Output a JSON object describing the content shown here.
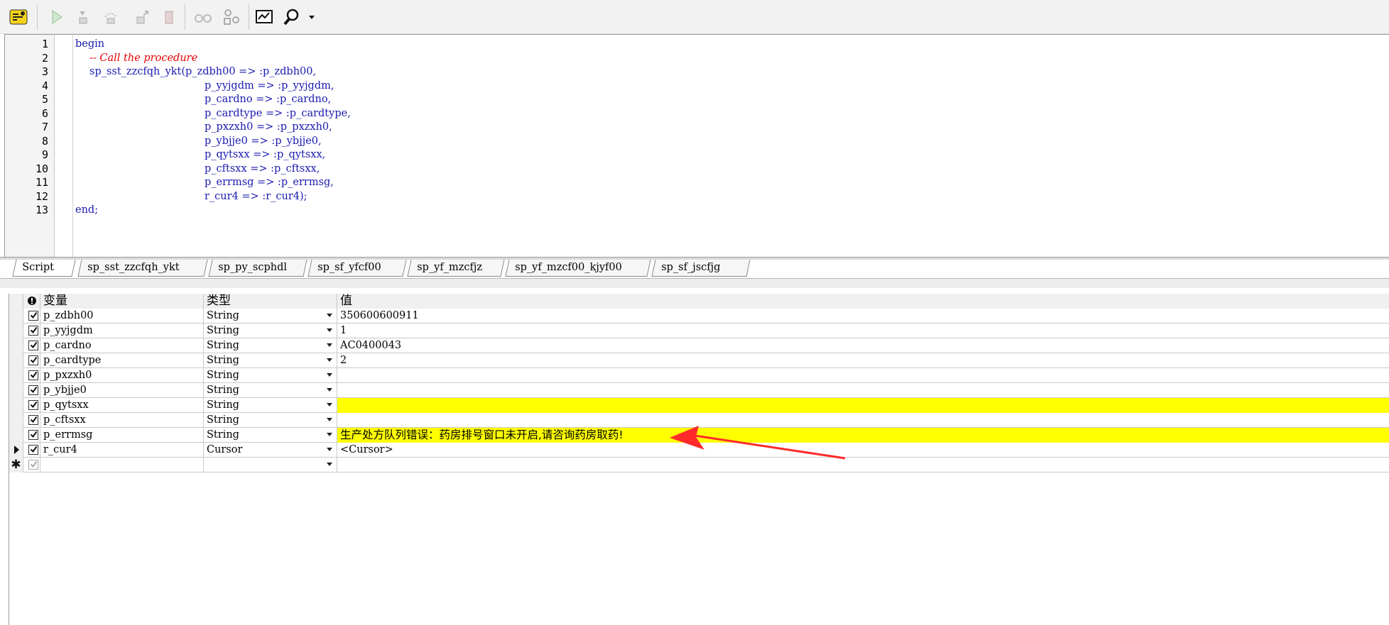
{
  "editor": {
    "lines": [
      {
        "n": "1",
        "text": "begin",
        "indent": 0,
        "kind": "code"
      },
      {
        "n": "2",
        "text": "-- Call the procedure",
        "indent": 20,
        "kind": "comment"
      },
      {
        "n": "3",
        "text": "sp_sst_zzcfqh_ykt(p_zdbh00 => :p_zdbh00,",
        "indent": 20,
        "kind": "code"
      },
      {
        "n": "4",
        "text": "p_yyjgdm => :p_yyjgdm,",
        "indent": 182,
        "kind": "code"
      },
      {
        "n": "5",
        "text": "p_cardno => :p_cardno,",
        "indent": 182,
        "kind": "code"
      },
      {
        "n": "6",
        "text": "p_cardtype => :p_cardtype,",
        "indent": 182,
        "kind": "code"
      },
      {
        "n": "7",
        "text": "p_pxzxh0 => :p_pxzxh0,",
        "indent": 182,
        "kind": "code"
      },
      {
        "n": "8",
        "text": "p_ybjje0 => :p_ybjje0,",
        "indent": 182,
        "kind": "code"
      },
      {
        "n": "9",
        "text": "p_qytsxx => :p_qytsxx,",
        "indent": 182,
        "kind": "code"
      },
      {
        "n": "10",
        "text": "p_cftsxx => :p_cftsxx,",
        "indent": 182,
        "kind": "code"
      },
      {
        "n": "11",
        "text": "p_errmsg => :p_errmsg,",
        "indent": 182,
        "kind": "code"
      },
      {
        "n": "12",
        "text": "r_cur4 => :r_cur4);",
        "indent": 182,
        "kind": "code"
      },
      {
        "n": "13",
        "text": "end;",
        "indent": 0,
        "kind": "code"
      }
    ]
  },
  "tabs": [
    {
      "label": "Script",
      "active": true
    },
    {
      "label": "sp_sst_zzcfqh_ykt",
      "active": false
    },
    {
      "label": "sp_py_scphdl",
      "active": false
    },
    {
      "label": "sp_sf_yfcf00",
      "active": false
    },
    {
      "label": "sp_yf_mzcfjz",
      "active": false
    },
    {
      "label": "sp_yf_mzcf00_kjyf00",
      "active": false
    },
    {
      "label": "sp_sf_jscfjg",
      "active": false
    }
  ],
  "grid": {
    "headers": {
      "variable": "变量",
      "type": "类型",
      "value": "值"
    },
    "rows": [
      {
        "name": "p_zdbh00",
        "type": "String",
        "value": "350600600911",
        "highlight": false,
        "checked": true
      },
      {
        "name": "p_yyjgdm",
        "type": "String",
        "value": "1",
        "highlight": false,
        "checked": true
      },
      {
        "name": "p_cardno",
        "type": "String",
        "value": "AC0400043",
        "highlight": false,
        "checked": true
      },
      {
        "name": "p_cardtype",
        "type": "String",
        "value": "2",
        "highlight": false,
        "checked": true
      },
      {
        "name": "p_pxzxh0",
        "type": "String",
        "value": "",
        "highlight": false,
        "checked": true
      },
      {
        "name": "p_ybjje0",
        "type": "String",
        "value": "",
        "highlight": false,
        "checked": true
      },
      {
        "name": "p_qytsxx",
        "type": "String",
        "value": "",
        "highlight": true,
        "checked": true
      },
      {
        "name": "p_cftsxx",
        "type": "String",
        "value": "",
        "highlight": false,
        "checked": true
      },
      {
        "name": "p_errmsg",
        "type": "String",
        "value": "生产处方队列错误：药房排号窗口未开启,请咨询药房取药!",
        "highlight": true,
        "checked": true
      },
      {
        "name": "r_cur4",
        "type": "Cursor",
        "value": "<Cursor>",
        "highlight": false,
        "checked": true,
        "current": true
      },
      {
        "name": "",
        "type": "",
        "value": "",
        "highlight": false,
        "checked": true,
        "new": true
      }
    ]
  },
  "colors": {
    "highlight": "#ffff00",
    "keyword": "#1a1ab0",
    "comment": "#e60000",
    "annotation_arrow": "#ff2a2a"
  },
  "icons": [
    "explain-plan-icon",
    "execute-icon",
    "step-into-icon",
    "step-over-icon",
    "step-out-icon",
    "run-to-exception-icon",
    "toggle-breakpoint-icon",
    "watch-icon",
    "monitor-icon",
    "find-icon"
  ]
}
